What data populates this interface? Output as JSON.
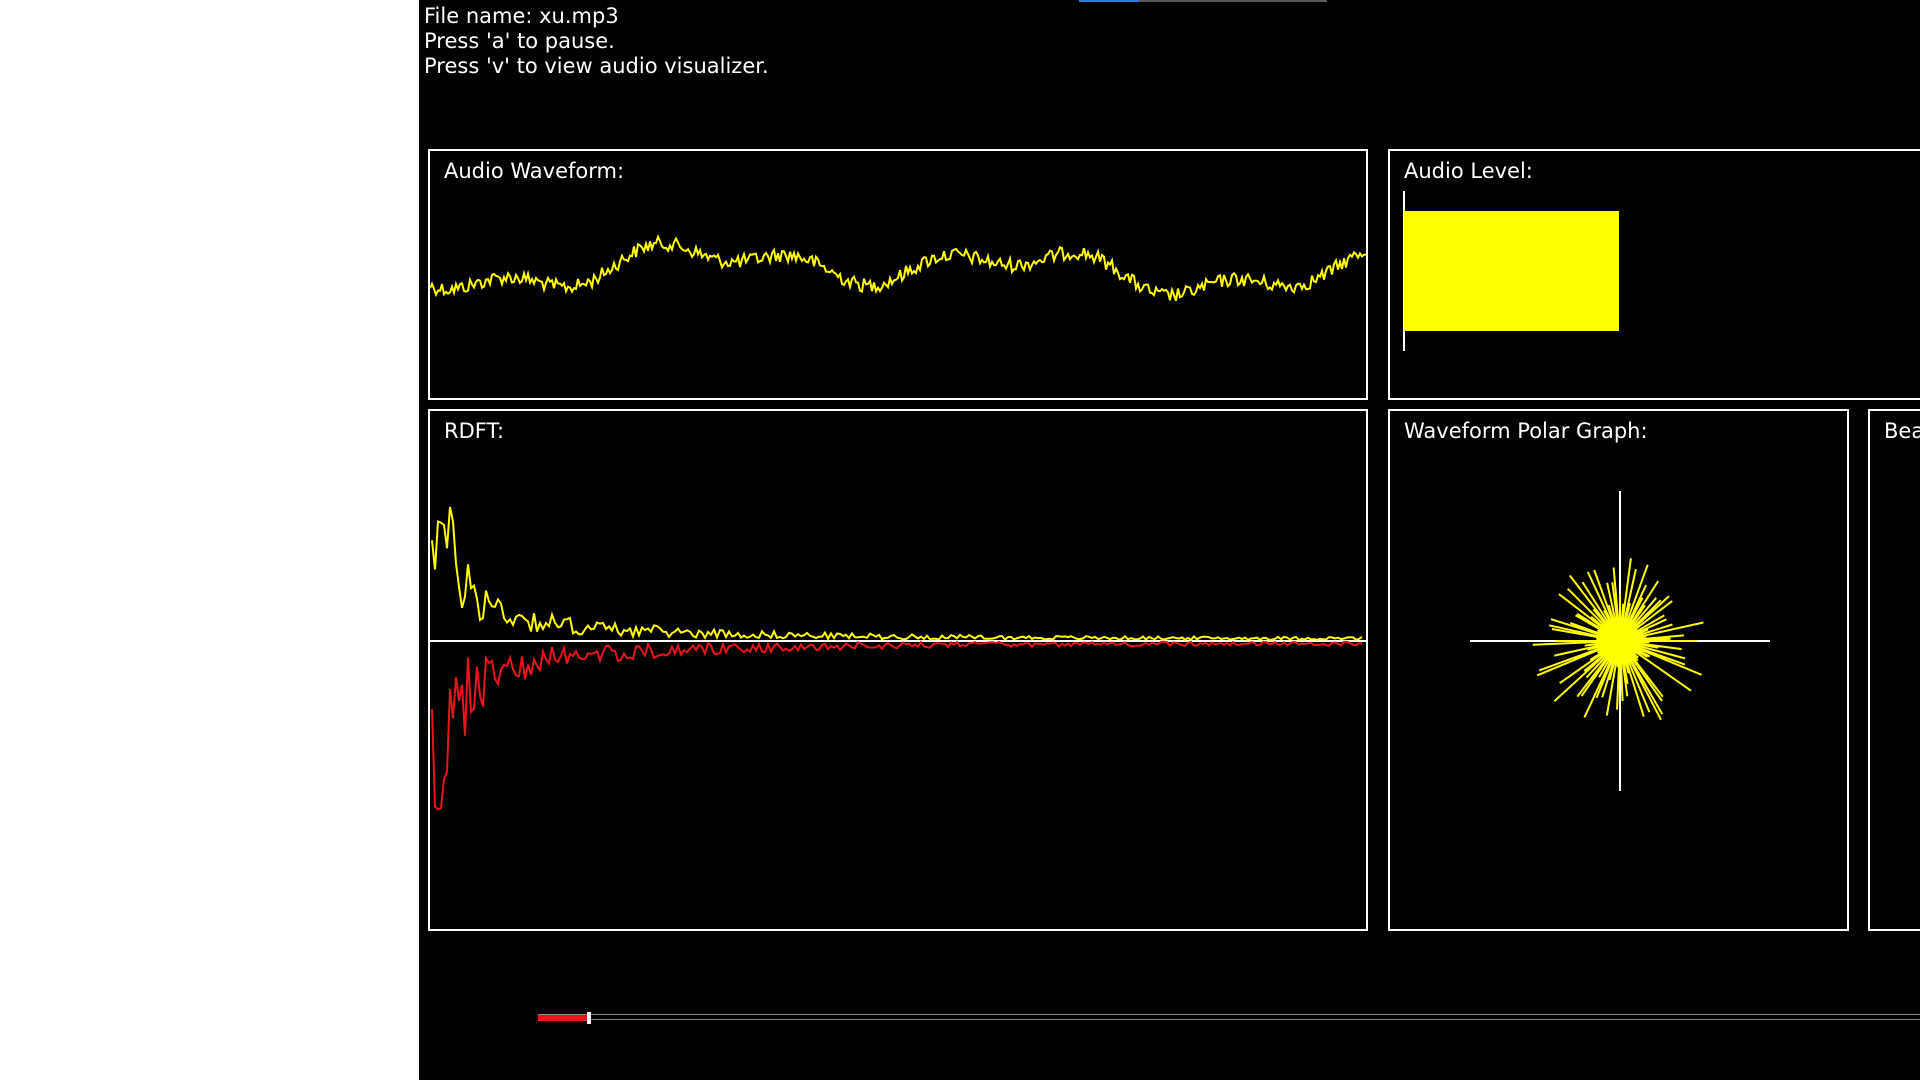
{
  "info": {
    "file_name": "File name: xu.mp3",
    "hint_pause": "Press 'a' to pause.",
    "hint_visualizer": "Press 'v' to view audio visualizer."
  },
  "panels": {
    "waveform_title": "Audio Waveform:",
    "level_title": "Audio Level:",
    "rdft_title": "RDFT:",
    "polar_title": "Waveform Polar Graph:",
    "beat_title": "Bea"
  },
  "audio_level": 0.65,
  "playback_progress": 0.03,
  "colors": {
    "background": "#000000",
    "border": "#ffffff",
    "waveform": "#ffff00",
    "rdft_positive": "#ffff00",
    "rdft_negative": "#e8151b",
    "level_bar": "#ffff00",
    "progress_fill": "#e8151b"
  }
}
